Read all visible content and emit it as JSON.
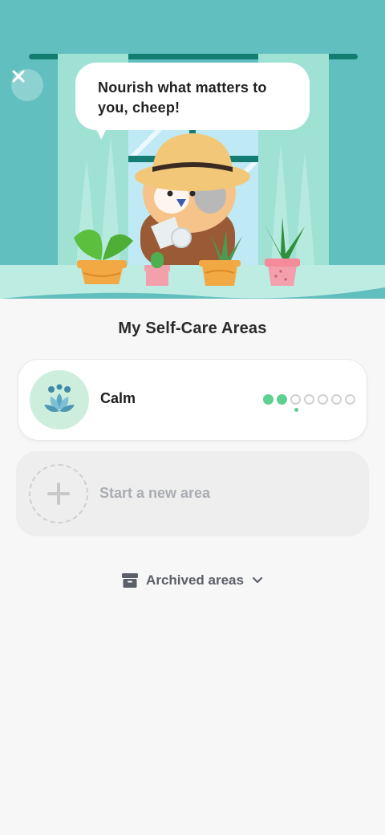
{
  "header": {
    "close_icon": "close-icon",
    "speech_bubble": "Nourish what matters to you, cheep!"
  },
  "section": {
    "title": "My Self-Care Areas"
  },
  "areas": [
    {
      "name": "Calm",
      "icon": "lotus-icon",
      "progress": {
        "completed": 2,
        "total": 7,
        "current_index": 2
      }
    }
  ],
  "new_area": {
    "label": "Start a new area",
    "icon": "plus-icon"
  },
  "archived": {
    "label": "Archived areas",
    "icon": "archive-box-icon",
    "chevron": "chevron-down-icon"
  },
  "colors": {
    "hero_bg": "#62bfc0",
    "accent_green": "#5fd08f",
    "page_bg": "#f7f7f7"
  }
}
